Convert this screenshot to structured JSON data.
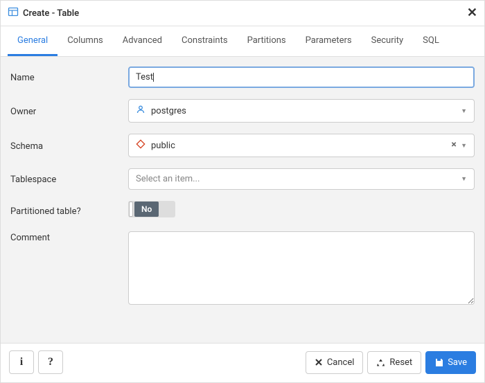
{
  "dialog": {
    "title": "Create - Table"
  },
  "tabs": [
    {
      "label": "General"
    },
    {
      "label": "Columns"
    },
    {
      "label": "Advanced"
    },
    {
      "label": "Constraints"
    },
    {
      "label": "Partitions"
    },
    {
      "label": "Parameters"
    },
    {
      "label": "Security"
    },
    {
      "label": "SQL"
    }
  ],
  "form": {
    "name_label": "Name",
    "name_value": "Test",
    "owner_label": "Owner",
    "owner_value": "postgres",
    "schema_label": "Schema",
    "schema_value": "public",
    "tablespace_label": "Tablespace",
    "tablespace_placeholder": "Select an item...",
    "partitioned_label": "Partitioned table?",
    "partitioned_value": "No",
    "comment_label": "Comment",
    "comment_value": ""
  },
  "footer": {
    "cancel": "Cancel",
    "reset": "Reset",
    "save": "Save"
  }
}
